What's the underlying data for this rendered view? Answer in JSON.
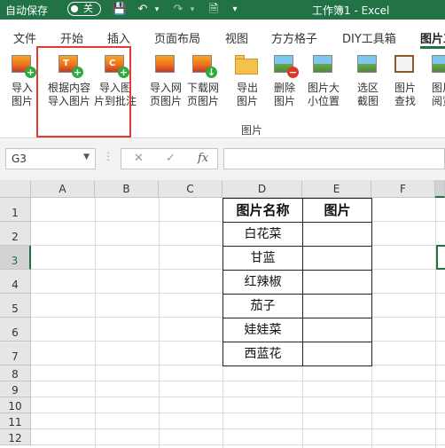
{
  "titlebar": {
    "autosave_label": "自动保存",
    "autosave_state": "关",
    "doc_title": "工作簿1  -  Excel"
  },
  "tabs": [
    {
      "label": "文件"
    },
    {
      "label": "开始"
    },
    {
      "label": "插入"
    },
    {
      "label": "页面布局"
    },
    {
      "label": "视图"
    },
    {
      "label": "方方格子"
    },
    {
      "label": "DIY工具箱"
    },
    {
      "label": "图片工"
    }
  ],
  "ribbon": {
    "buttons": [
      {
        "line1": "导入",
        "line2": "图片",
        "icon": "insert-picture-icon"
      },
      {
        "line1": "根据内容",
        "line2": "导入图片",
        "icon": "import-by-content-icon"
      },
      {
        "line1": "导入图",
        "line2": "片到批注",
        "icon": "import-to-comment-icon"
      },
      {
        "line1": "导入网",
        "line2": "页图片",
        "icon": "import-web-picture-icon"
      },
      {
        "line1": "下载网",
        "line2": "页图片",
        "icon": "download-web-picture-icon"
      },
      {
        "line1": "导出",
        "line2": "图片",
        "icon": "export-picture-icon"
      },
      {
        "line1": "删除",
        "line2": "图片",
        "icon": "delete-picture-icon"
      },
      {
        "line1": "图片大",
        "line2": "小位置",
        "icon": "picture-size-position-icon"
      },
      {
        "line1": "选区",
        "line2": "截图",
        "icon": "selection-screenshot-icon"
      },
      {
        "line1": "图片",
        "line2": "查找",
        "icon": "picture-find-icon"
      },
      {
        "line1": "图片",
        "line2": "阅览",
        "icon": "picture-view-icon"
      }
    ],
    "group_label": "图片"
  },
  "formula_bar": {
    "name_box": "G3",
    "fx": "fx",
    "cancel": "✕",
    "confirm": "✓"
  },
  "sheet": {
    "columns": [
      "A",
      "B",
      "C",
      "D",
      "E",
      "F"
    ],
    "rows": [
      "1",
      "2",
      "3",
      "4",
      "5",
      "6",
      "7",
      "8",
      "9",
      "10",
      "11",
      "12"
    ],
    "table_header": [
      "图片名称",
      "图片"
    ],
    "table_rows": [
      "白花菜",
      "甘蓝",
      "红辣椒",
      "茄子",
      "娃娃菜",
      "西蓝花"
    ]
  },
  "colors": {
    "excel_green": "#217346",
    "highlight_red": "#e53935"
  }
}
